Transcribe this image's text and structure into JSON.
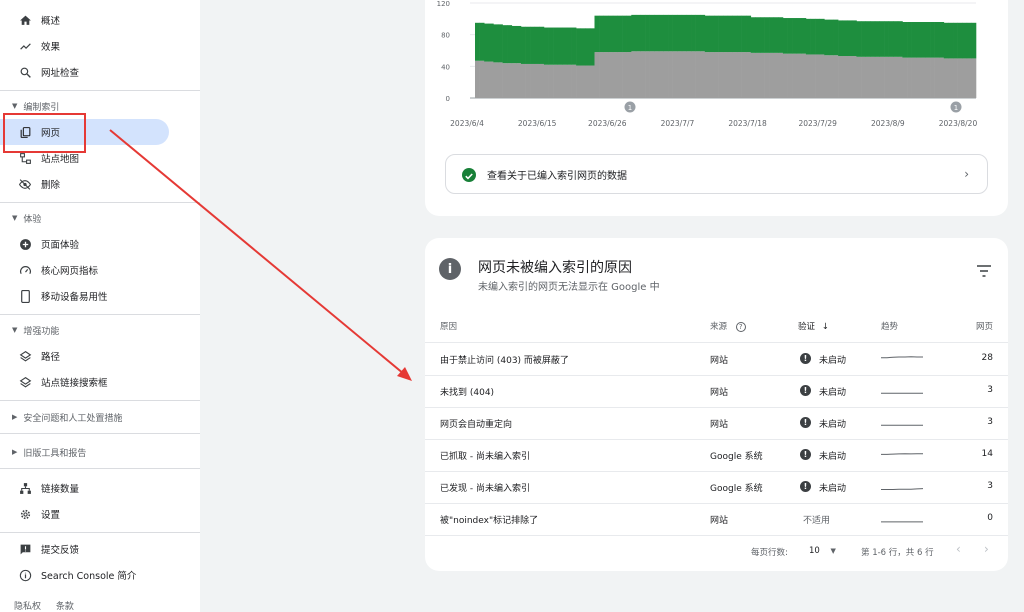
{
  "sidebar": {
    "top_items": [
      {
        "label": "概述",
        "icon": "home-icon"
      },
      {
        "label": "效果",
        "icon": "trending-up-icon"
      },
      {
        "label": "网址检查",
        "icon": "search-icon"
      }
    ],
    "sections": [
      {
        "label": "编制索引",
        "items": [
          {
            "label": "网页",
            "icon": "pages-icon",
            "active": true
          },
          {
            "label": "站点地图",
            "icon": "sitemap-icon"
          },
          {
            "label": "删除",
            "icon": "visibility-off-icon"
          }
        ]
      },
      {
        "label": "体验",
        "items": [
          {
            "label": "页面体验",
            "icon": "add-circle-icon"
          },
          {
            "label": "核心网页指标",
            "icon": "speed-icon"
          },
          {
            "label": "移动设备易用性",
            "icon": "smartphone-icon"
          }
        ]
      },
      {
        "label": "增强功能",
        "items": [
          {
            "label": "路径",
            "icon": "layers-icon"
          },
          {
            "label": "站点链接搜索框",
            "icon": "layers-icon"
          }
        ]
      }
    ],
    "collapsed_sections": [
      "安全问题和人工处置措施",
      "旧版工具和报告"
    ],
    "bottom_items": [
      {
        "label": "链接数量",
        "icon": "links-icon"
      },
      {
        "label": "设置",
        "icon": "gear-icon"
      }
    ],
    "footer_items": [
      {
        "label": "提交反馈",
        "icon": "feedback-icon"
      },
      {
        "label": "Search Console 简介",
        "icon": "info-icon"
      }
    ],
    "footer_links": [
      "隐私权",
      "条款"
    ]
  },
  "chart_data": {
    "type": "bar",
    "stacked": true,
    "ylim": [
      0,
      120
    ],
    "yticks": [
      0,
      40,
      80,
      120
    ],
    "xticks": [
      "2023/6/4",
      "2023/6/15",
      "2023/6/26",
      "2023/7/7",
      "2023/7/18",
      "2023/7/29",
      "2023/8/9",
      "2023/8/20"
    ],
    "series": [
      {
        "color": "#9e9e9e",
        "values": [
          47,
          47,
          46,
          46,
          45,
          45,
          44,
          44,
          44,
          44,
          43,
          43,
          43,
          43,
          43,
          42,
          42,
          42,
          42,
          42,
          42,
          42,
          41,
          41,
          41,
          41,
          58,
          58,
          58,
          58,
          58,
          58,
          58,
          58,
          59,
          59,
          59,
          59,
          59,
          59,
          59,
          59,
          59,
          59,
          59,
          59,
          59,
          59,
          59,
          59,
          58,
          58,
          58,
          58,
          58,
          58,
          58,
          58,
          58,
          58,
          57,
          57,
          57,
          57,
          57,
          57,
          57,
          56,
          56,
          56,
          56,
          56,
          55,
          55,
          55,
          55,
          54,
          54,
          54,
          53,
          53,
          53,
          53,
          52,
          52,
          52,
          52,
          52,
          52,
          52,
          52,
          52,
          52,
          51,
          51,
          51,
          51,
          51,
          51,
          51,
          51,
          51,
          50,
          50,
          50,
          50,
          50,
          50,
          50
        ]
      },
      {
        "color": "#1e8e3e",
        "values": [
          48,
          48,
          48,
          48,
          48,
          48,
          48,
          48,
          47,
          47,
          47,
          47,
          47,
          47,
          47,
          47,
          47,
          47,
          47,
          47,
          47,
          47,
          47,
          47,
          47,
          47,
          46,
          46,
          46,
          46,
          46,
          46,
          46,
          46,
          46,
          46,
          46,
          46,
          46,
          46,
          46,
          46,
          46,
          46,
          46,
          46,
          46,
          46,
          46,
          46,
          46,
          46,
          46,
          46,
          46,
          46,
          46,
          46,
          46,
          46,
          45,
          45,
          45,
          45,
          45,
          45,
          45,
          45,
          45,
          45,
          45,
          45,
          45,
          45,
          45,
          45,
          45,
          45,
          45,
          45,
          45,
          45,
          45,
          45,
          45,
          45,
          45,
          45,
          45,
          45,
          45,
          45,
          45,
          45,
          45,
          45,
          45,
          45,
          45,
          45,
          45,
          45,
          45,
          45,
          45,
          45,
          45,
          45,
          45
        ]
      }
    ],
    "annotation_label": "1"
  },
  "index_link": {
    "label": "查看关于已编入索引网页的数据"
  },
  "reasons_card": {
    "title": "网页未被编入索引的原因",
    "subtitle": "未编入索引的网页无法显示在 Google 中",
    "headers": {
      "reason": "原因",
      "source": "来源",
      "validation": "验证",
      "trend": "趋势",
      "pages": "网页"
    },
    "rows": [
      {
        "reason": "由于禁止访问 (403) 而被屏蔽了",
        "source": "网站",
        "validation": "未启动",
        "pages": "28",
        "trend": [
          0.55,
          0.55,
          0.52,
          0.5,
          0.5,
          0.48,
          0.5,
          0.5
        ]
      },
      {
        "reason": "未找到 (404)",
        "source": "网站",
        "validation": "未启动",
        "pages": "3",
        "trend": [
          0.8,
          0.8,
          0.8,
          0.8,
          0.8,
          0.8,
          0.8,
          0.8
        ]
      },
      {
        "reason": "网页会自动重定向",
        "source": "网站",
        "validation": "未启动",
        "pages": "3",
        "trend": [
          0.8,
          0.8,
          0.8,
          0.8,
          0.8,
          0.8,
          0.8,
          0.8
        ]
      },
      {
        "reason": "已抓取 - 尚未编入索引",
        "source": "Google 系统",
        "validation": "未启动",
        "pages": "14",
        "trend": [
          0.6,
          0.6,
          0.58,
          0.56,
          0.55,
          0.56,
          0.55,
          0.55
        ]
      },
      {
        "reason": "已发现 - 尚未编入索引",
        "source": "Google 系统",
        "validation": "未启动",
        "pages": "3",
        "trend": [
          0.82,
          0.82,
          0.82,
          0.8,
          0.8,
          0.8,
          0.78,
          0.76
        ]
      },
      {
        "reason": "被\"noindex\"标记排除了",
        "source": "网站",
        "validation": "不适用",
        "pages": "0",
        "trend": [
          0.85,
          0.85,
          0.85,
          0.85,
          0.85,
          0.85,
          0.85,
          0.85
        ]
      }
    ],
    "pager": {
      "rows_per_page_label": "每页行数:",
      "rows_per_page": "10",
      "range": "第 1-6 行，共 6 行"
    }
  },
  "colors": {
    "accent": "#1a73e8",
    "highlight_box": "#e53935",
    "active_nav_bg": "#d3e3fd"
  }
}
